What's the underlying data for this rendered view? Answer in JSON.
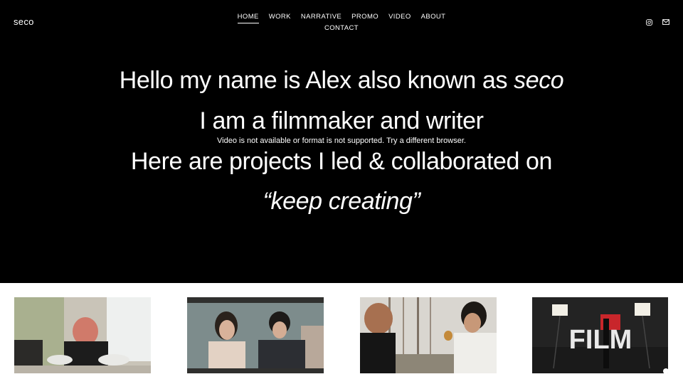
{
  "site": {
    "logo": "seco"
  },
  "nav": {
    "row1": [
      "HOME",
      "WORK",
      "NARRATIVE",
      "PROMO",
      "VIDEO",
      "ABOUT"
    ],
    "row2": [
      "CONTACT"
    ],
    "active": "HOME"
  },
  "social": {
    "icons": [
      "instagram-icon",
      "mail-icon"
    ]
  },
  "hero": {
    "line1_prefix": "Hello my name is Alex also known as ",
    "line1_emphasis": "seco",
    "line2": "I am a filmmaker and writer",
    "line3": "Here are projects I led & collaborated on",
    "line4": "“keep creating”",
    "video_message": "Video is not available or format is not supported. Try a different browser."
  },
  "gallery": {
    "thumb4_text": "FILM"
  },
  "colors": {
    "hero_bg": "#000000",
    "text": "#ffffff",
    "page_bg": "#ffffff"
  }
}
